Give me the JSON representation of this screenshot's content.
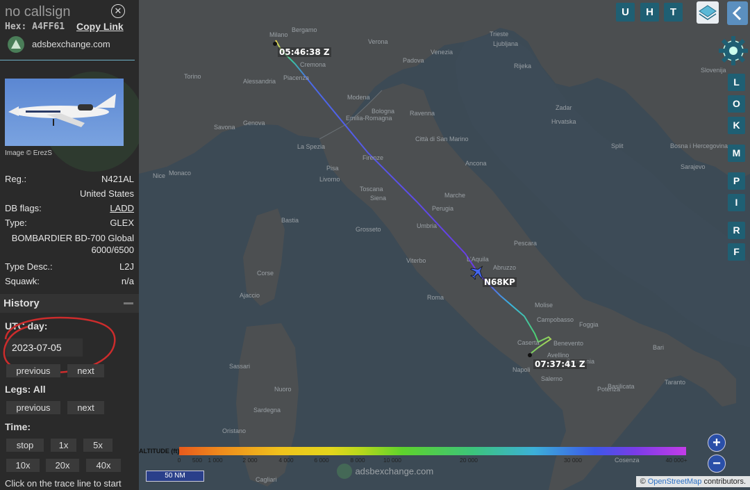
{
  "aircraft": {
    "callsign": "no callsign",
    "hex_label": "Hex:",
    "hex": "A4FF61",
    "copy_link": "Copy Link",
    "site": "adsbexchange.com",
    "image_credit": "Image © ErezS",
    "reg_label": "Reg.:",
    "reg": "N421AL",
    "country": "United States",
    "dbflags_label": "DB flags:",
    "dbflags": "LADD",
    "type_label": "Type:",
    "type": "GLEX",
    "type_name": "BOMBARDIER BD-700 Global 6000/6500",
    "typedesc_label": "Type Desc.:",
    "typedesc": "L2J",
    "squawk_label": "Squawk:",
    "squawk": "n/a"
  },
  "history": {
    "title": "History",
    "utc_label": "UTC day:",
    "date": "2023-07-05",
    "prev": "previous",
    "next": "next",
    "legs_label": "Legs: All",
    "legs_prev": "previous",
    "legs_next": "next",
    "time_label": "Time:",
    "stop": "stop",
    "s1": "1x",
    "s5": "5x",
    "s10": "10x",
    "s20": "20x",
    "s40": "40x",
    "hint": "Click on the trace line to start"
  },
  "map": {
    "start_time": "05:46:38 Z",
    "end_time": "07:37:41 Z",
    "flight_label": "N68KP",
    "buttons": {
      "u": "U",
      "h": "H",
      "t": "T"
    },
    "side_buttons": [
      "L",
      "O",
      "K",
      "M",
      "P",
      "I",
      "R",
      "F"
    ],
    "altitude_label": "ALTITUDE (ft)",
    "altitude_ticks": [
      "0",
      "500",
      "1 000",
      "2 000",
      "4 000",
      "6 000",
      "8 000",
      "10 000",
      "20 000",
      "30 000",
      "40 000+"
    ],
    "scale": "50 NM",
    "watermark": "adsbexchange.com",
    "attribution_prefix": "©",
    "attribution_link": "OpenStreetMap",
    "attribution_suffix": "contributors.",
    "zoom_in": "+",
    "zoom_out": "−",
    "places": [
      "Milano",
      "Trieste",
      "Torino",
      "Genova",
      "Cremona",
      "Piacenza",
      "Modena",
      "Bologna",
      "Ravenna",
      "Firenze",
      "Siena",
      "Perugia",
      "L'Aquila",
      "Pescara",
      "Roma",
      "Viterbo",
      "Napoli",
      "Caserta",
      "Benevento",
      "Foggia",
      "Bari",
      "Taranto",
      "Salerno",
      "Avellino",
      "Ajaccio",
      "Bastia",
      "Sassari",
      "Cagliari",
      "Oristano",
      "Nuoro",
      "Monaco",
      "Nice",
      "Ancona",
      "Grosseto",
      "Hrvatska",
      "Split",
      "Zadar",
      "Rijeka",
      "Bosna i Hercegovina",
      "Sarajevo",
      "Slovenija",
      "Ljubljana",
      "Campobasso",
      "Potenza",
      "Cosenza",
      "Marche",
      "Toscana",
      "Umbria",
      "Abruzzo",
      "Molise",
      "Campania",
      "Basilicata",
      "Sardegna",
      "Corse",
      "Emilia-Romagna",
      "Città di San Marino",
      "La Spezia",
      "Livorno",
      "Pisa",
      "Savona",
      "Alessandria",
      "Bergamo",
      "Verona",
      "Venezia",
      "Padova"
    ]
  }
}
